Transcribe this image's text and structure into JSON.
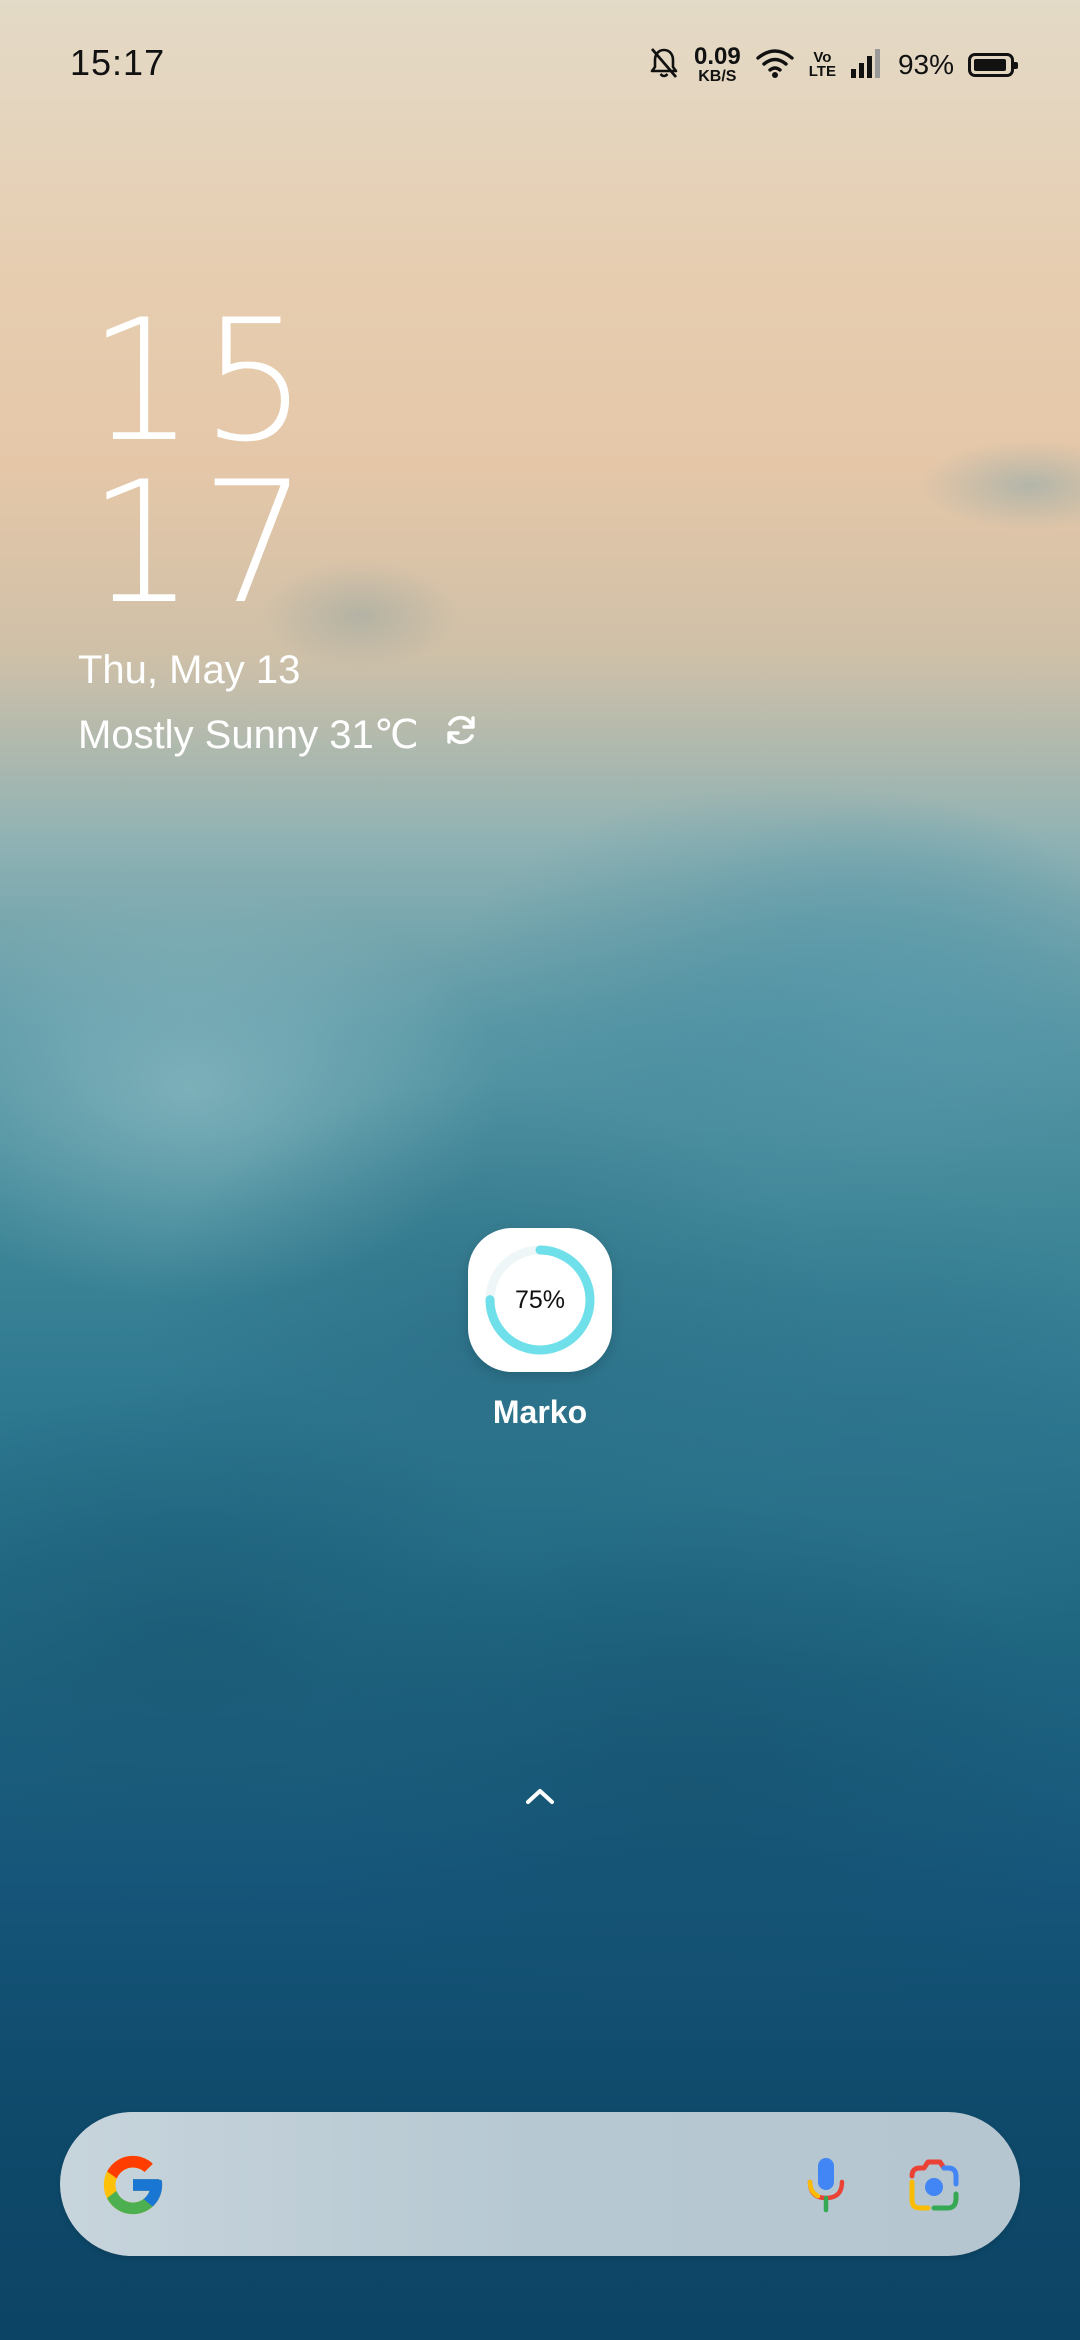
{
  "status_bar": {
    "time": "15:17",
    "net_speed_value": "0.09",
    "net_speed_unit": "KB/S",
    "volte_top": "Vo",
    "volte_bottom": "LTE",
    "battery_percent": "93%",
    "battery_level": 0.93,
    "icons": [
      "bell-off-icon",
      "wifi-icon",
      "signal-icon",
      "battery-icon"
    ]
  },
  "clock_widget": {
    "hours": "15",
    "minutes": "17",
    "date": "Thu, May 13",
    "weather": "Mostly Sunny 31℃",
    "refresh_icon": "refresh-icon"
  },
  "home": {
    "app": {
      "label": "Marko",
      "progress_text": "75%",
      "progress": 0.75,
      "ring_color": "#6fe0ea"
    },
    "swipe_up_icon": "chevron-up-icon"
  },
  "search_bar": {
    "logo": "google-logo-icon",
    "mic_icon": "microphone-icon",
    "lens_icon": "google-lens-icon"
  }
}
